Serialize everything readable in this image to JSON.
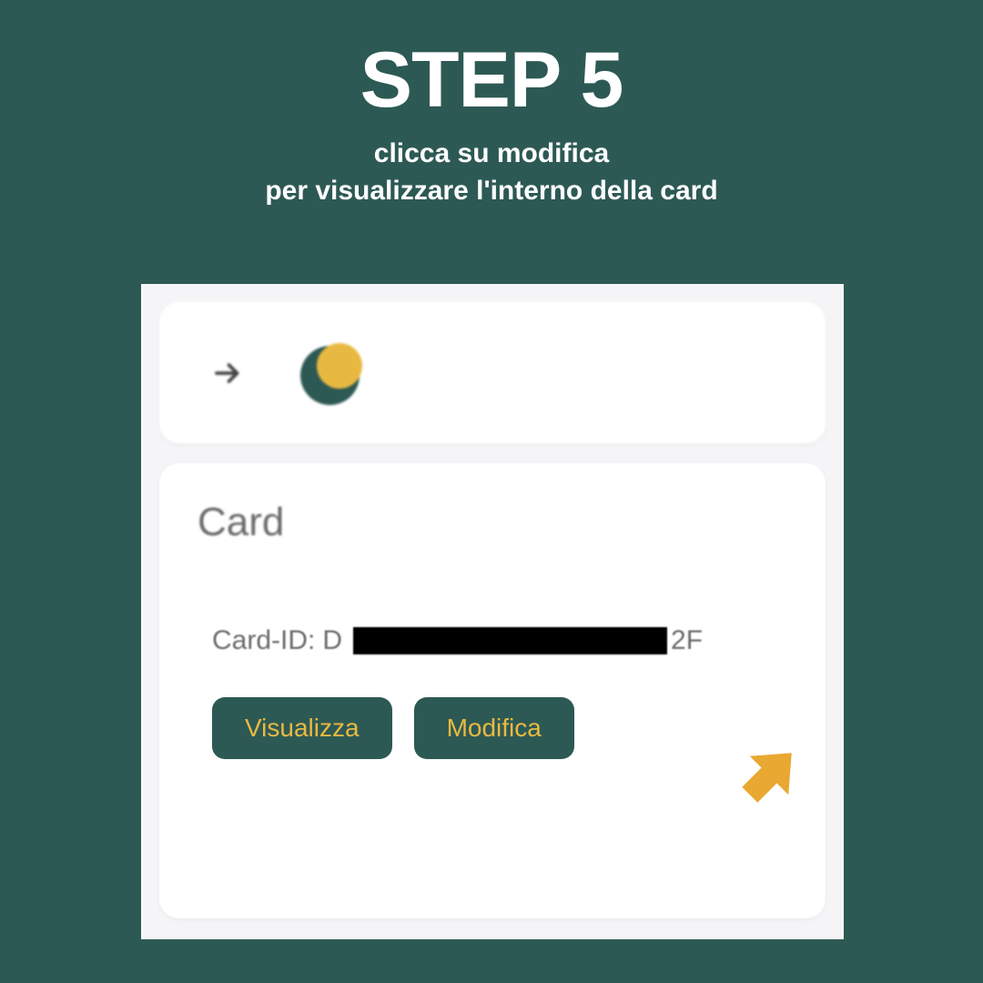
{
  "header": {
    "title": "STEP 5",
    "subtitle_line1": "clicca su modifica",
    "subtitle_line2": "per visualizzare l'interno della card"
  },
  "card": {
    "title": "Card",
    "id_label": "Card-ID:",
    "id_prefix": "D",
    "id_suffix": "2F"
  },
  "buttons": {
    "view": "Visualizza",
    "edit": "Modifica"
  }
}
